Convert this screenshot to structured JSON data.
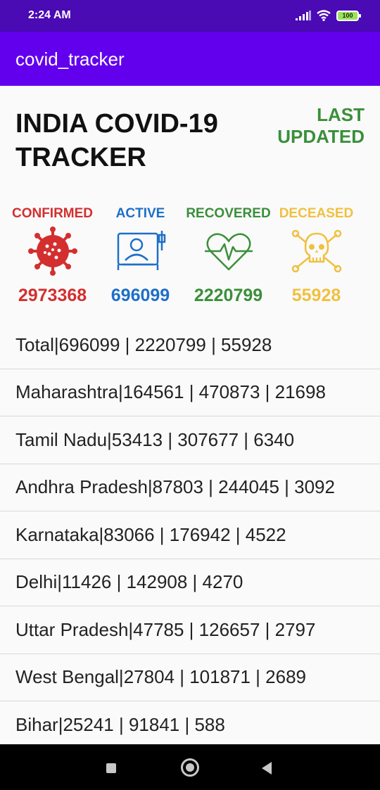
{
  "status_bar": {
    "time": "2:24 AM",
    "battery": "100"
  },
  "app_bar": {
    "title": "covid_tracker"
  },
  "header": {
    "title": "INDIA COVID-19 TRACKER",
    "last_updated": "LAST UPDATED",
    "last_updated_color": "#3a8f3a"
  },
  "stats": [
    {
      "label": "CONFIRMED",
      "value": "2973368",
      "color": "#d32f2f",
      "icon": "virus-icon"
    },
    {
      "label": "ACTIVE",
      "value": "696099",
      "color": "#1e6fc8",
      "icon": "patient-bed-icon"
    },
    {
      "label": "RECOVERED",
      "value": "2220799",
      "color": "#3a8f3a",
      "icon": "heartbeat-icon"
    },
    {
      "label": "DECEASED",
      "value": "55928",
      "color": "#f0c040",
      "icon": "skull-crossbones-icon"
    }
  ],
  "states": [
    "Total|696099 | 2220799 | 55928",
    "Maharashtra|164561 | 470873 | 21698",
    "Tamil Nadu|53413 | 307677 | 6340",
    "Andhra Pradesh|87803 | 244045 | 3092",
    "Karnataka|83066 | 176942 | 4522",
    "Delhi|11426 | 142908 | 4270",
    "Uttar Pradesh|47785 | 126657 | 2797",
    "West Bengal|27804 | 101871 | 2689",
    "Bihar|25241 | 91841 | 588"
  ],
  "nav": {
    "icons": [
      "recents-square-icon",
      "home-circle-icon",
      "back-triangle-icon"
    ]
  }
}
